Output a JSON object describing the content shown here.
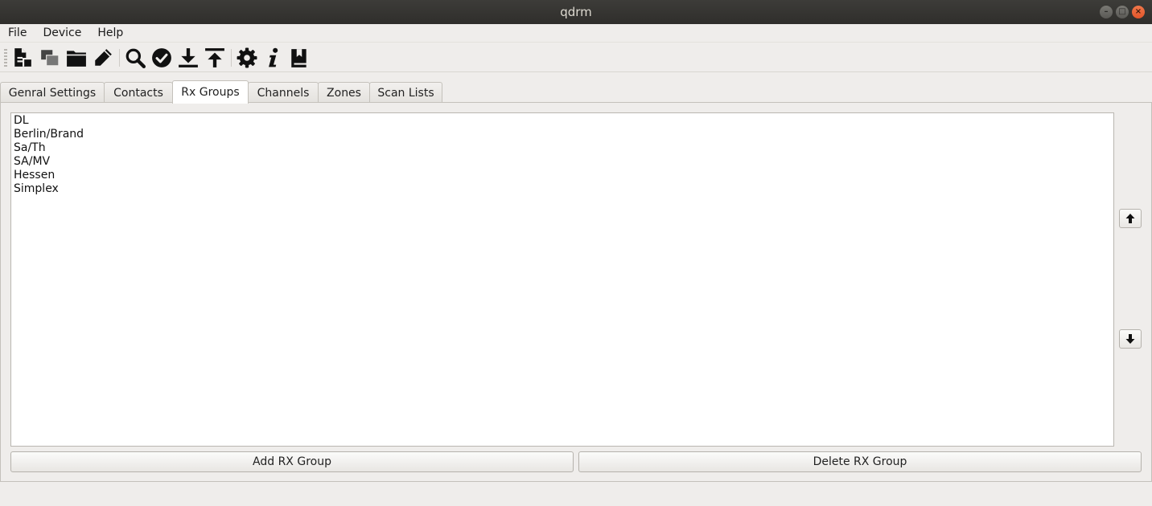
{
  "window": {
    "title": "qdrm"
  },
  "menubar": {
    "items": [
      "File",
      "Device",
      "Help"
    ]
  },
  "toolbar": {
    "icons": [
      "new-file-icon",
      "copy-icon",
      "open-folder-icon",
      "edit-pencil-icon",
      "search-icon",
      "verify-check-icon",
      "download-icon",
      "upload-icon",
      "settings-gear-icon",
      "info-icon",
      "bookmark-book-icon"
    ]
  },
  "tabs": [
    {
      "label": "Genral Settings",
      "active": false
    },
    {
      "label": "Contacts",
      "active": false
    },
    {
      "label": "Rx Groups",
      "active": true
    },
    {
      "label": "Channels",
      "active": false
    },
    {
      "label": "Zones",
      "active": false
    },
    {
      "label": "Scan Lists",
      "active": false
    }
  ],
  "rx_groups": {
    "items": [
      "DL",
      "Berlin/Brand",
      "Sa/Th",
      "SA/MV",
      "Hessen",
      "Simplex"
    ],
    "add_label": "Add RX Group",
    "delete_label": "Delete RX Group"
  }
}
